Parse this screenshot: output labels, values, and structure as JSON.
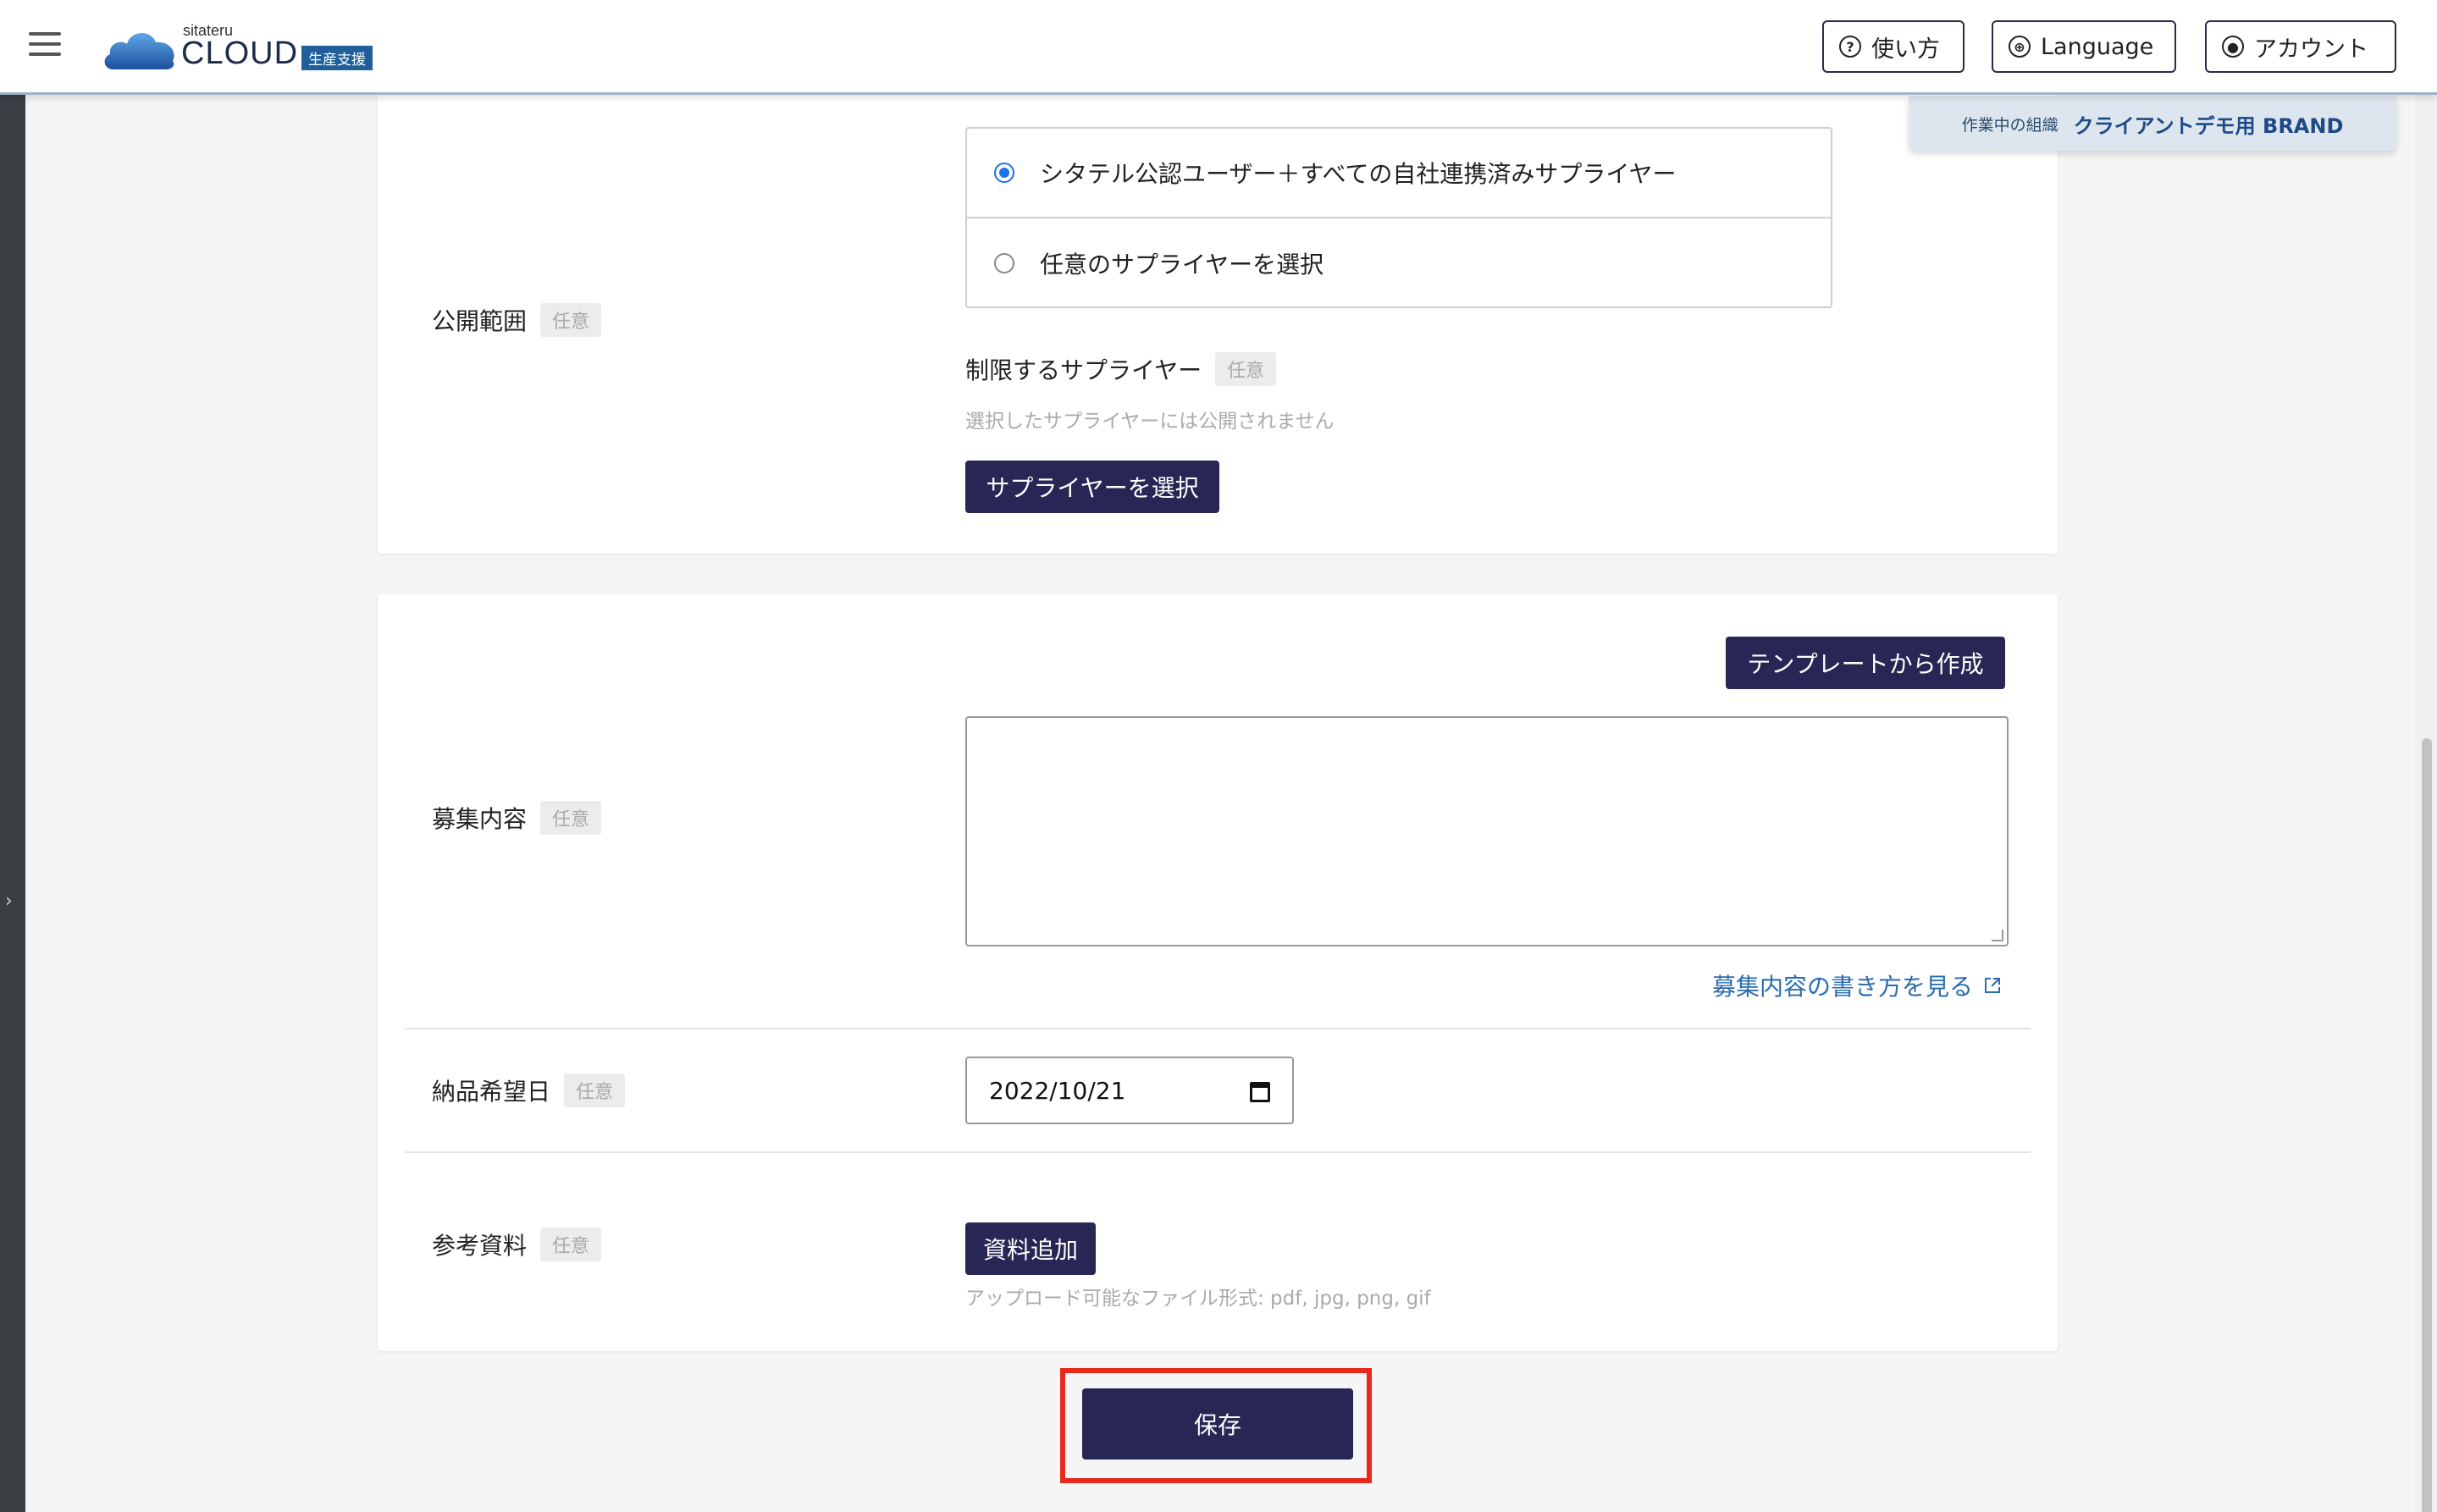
{
  "header": {
    "logo_small": "sitateru",
    "logo_big": "CLOUD",
    "logo_badge": "生産支援",
    "help_label": "使い方",
    "language_label": "Language",
    "account_label": "アカウント"
  },
  "org": {
    "label": "作業中の組織",
    "value": "クライアントデモ用 BRAND"
  },
  "optional_tag": "任意",
  "visibility": {
    "label": "公開範囲",
    "options": [
      {
        "label": "シタテル公認ユーザー＋すべての自社連携済みサプライヤー",
        "selected": true
      },
      {
        "label": "任意のサプライヤーを選択",
        "selected": false
      }
    ],
    "restrict_label": "制限するサプライヤー",
    "restrict_hint": "選択したサプライヤーには公開されません",
    "select_button": "サプライヤーを選択"
  },
  "recruit": {
    "label": "募集内容",
    "template_button": "テンプレートから作成",
    "textarea_value": "",
    "howto_link": "募集内容の書き方を見る"
  },
  "delivery": {
    "label": "納品希望日",
    "value": "2022/10/21"
  },
  "reference": {
    "label": "参考資料",
    "add_button": "資料追加",
    "hint": "アップロード可能なファイル形式: pdf, jpg, png, gif"
  },
  "save_button": "保存",
  "colors": {
    "primary_dark": "#272654",
    "accent_blue": "#1a73e8",
    "link_blue": "#2b6cb0",
    "highlight_red": "#e8291c"
  }
}
